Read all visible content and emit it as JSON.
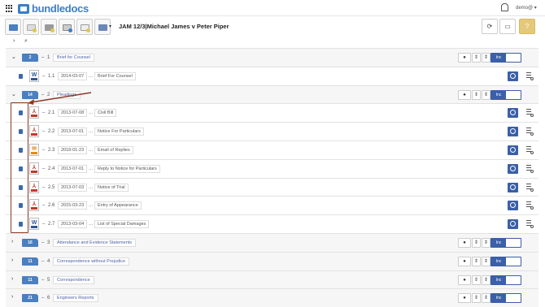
{
  "app": {
    "brand": "bundledocs",
    "user": "demo@"
  },
  "case_title": "JAM 12/3|Michael James v Peter Piper",
  "toolbar": {
    "buttons": [
      "add-bundle-icon",
      "add-document-icon",
      "add-section-icon",
      "upload-icon",
      "page-icon",
      "save-icon"
    ],
    "right": [
      "refresh-icon",
      "monitor-icon",
      "help-icon"
    ]
  },
  "controls": {
    "comment": "●",
    "updown": "⇕",
    "inc": "Inc"
  },
  "sections": [
    {
      "num": "1",
      "count": "2",
      "title": "Brief for Counsel",
      "expanded": true,
      "docs": [
        {
          "num": "1.1",
          "type": "W",
          "date": "2014-03-07",
          "desc": "Brief For Counsel"
        }
      ]
    },
    {
      "num": "2",
      "count": "14",
      "title": "Pleadings",
      "expanded": true,
      "docs": [
        {
          "num": "2.1",
          "type": "PDF",
          "date": "2013-07-08",
          "desc": "Civil Bill"
        },
        {
          "num": "2.2",
          "type": "PDF",
          "date": "2013-07-01",
          "desc": "Notice For Particulars"
        },
        {
          "num": "2.3",
          "type": "EML",
          "date": "2018-01-23",
          "desc": "Email of Replies"
        },
        {
          "num": "2.4",
          "type": "PDF",
          "date": "2013-07-01",
          "desc": "Reply to Notice for Particulars"
        },
        {
          "num": "2.5",
          "type": "PDF",
          "date": "2013-07-03",
          "desc": "Notice of Trial"
        },
        {
          "num": "2.6",
          "type": "PDF",
          "date": "2015-03-23",
          "desc": "Entry of Appearance"
        },
        {
          "num": "2.7",
          "type": "W",
          "date": "2013-03-04",
          "desc": "List of Special Damages"
        }
      ]
    },
    {
      "num": "3",
      "count": "16",
      "title": "Attendance and Evidence Statements",
      "expanded": false,
      "docs": []
    },
    {
      "num": "4",
      "count": "11",
      "title": "Correspondence without Prejudice",
      "expanded": false,
      "docs": []
    },
    {
      "num": "5",
      "count": "11",
      "title": "Correspondence",
      "expanded": false,
      "docs": []
    },
    {
      "num": "6",
      "count": "21",
      "title": "Engineers Reports",
      "expanded": false,
      "docs": []
    }
  ],
  "colors": {
    "accent": "#3b5fa8",
    "brand": "#3b7fc4",
    "highlight": "#8b3a2a",
    "help": "#e5c97a"
  }
}
